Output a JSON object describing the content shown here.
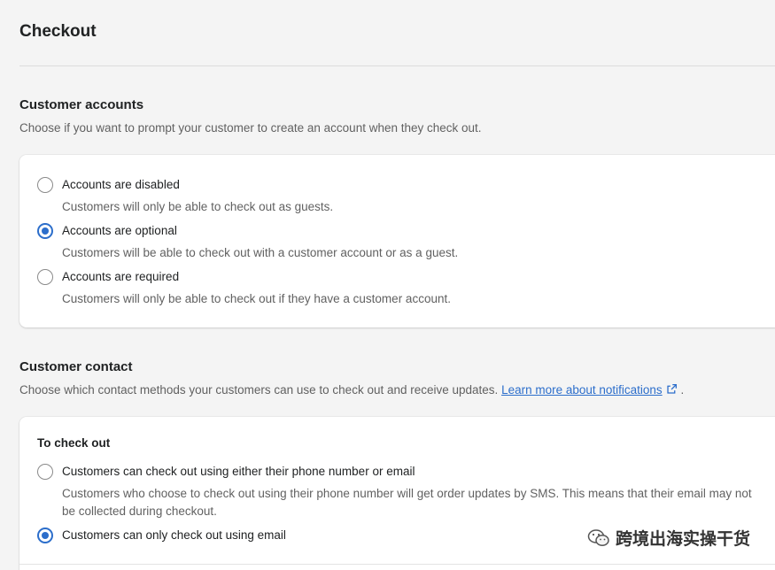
{
  "page": {
    "title": "Checkout"
  },
  "customer_accounts": {
    "title": "Customer accounts",
    "description": "Choose if you want to prompt your customer to create an account when they check out.",
    "options": [
      {
        "label": "Accounts are disabled",
        "help": "Customers will only be able to check out as guests.",
        "selected": false
      },
      {
        "label": "Accounts are optional",
        "help": "Customers will be able to check out with a customer account or as a guest.",
        "selected": true
      },
      {
        "label": "Accounts are required",
        "help": "Customers will only be able to check out if they have a customer account.",
        "selected": false
      }
    ]
  },
  "customer_contact": {
    "title": "Customer contact",
    "description": "Choose which contact methods your customers can use to check out and receive updates.",
    "link_text": "Learn more about notifications",
    "trailing": ".",
    "subhead": "To check out",
    "options": [
      {
        "label": "Customers can check out using either their phone number or email",
        "help": "Customers who choose to check out using their phone number will get order updates by SMS. This means that their email may not be collected during checkout.",
        "selected": false
      },
      {
        "label": "Customers can only check out using email",
        "help": "",
        "selected": true
      }
    ]
  },
  "watermark": {
    "text": "跨境出海实操干货"
  },
  "colors": {
    "accent": "#2c6ecb",
    "background": "#f4f4f4",
    "card": "#ffffff",
    "muted_text": "#616161"
  }
}
